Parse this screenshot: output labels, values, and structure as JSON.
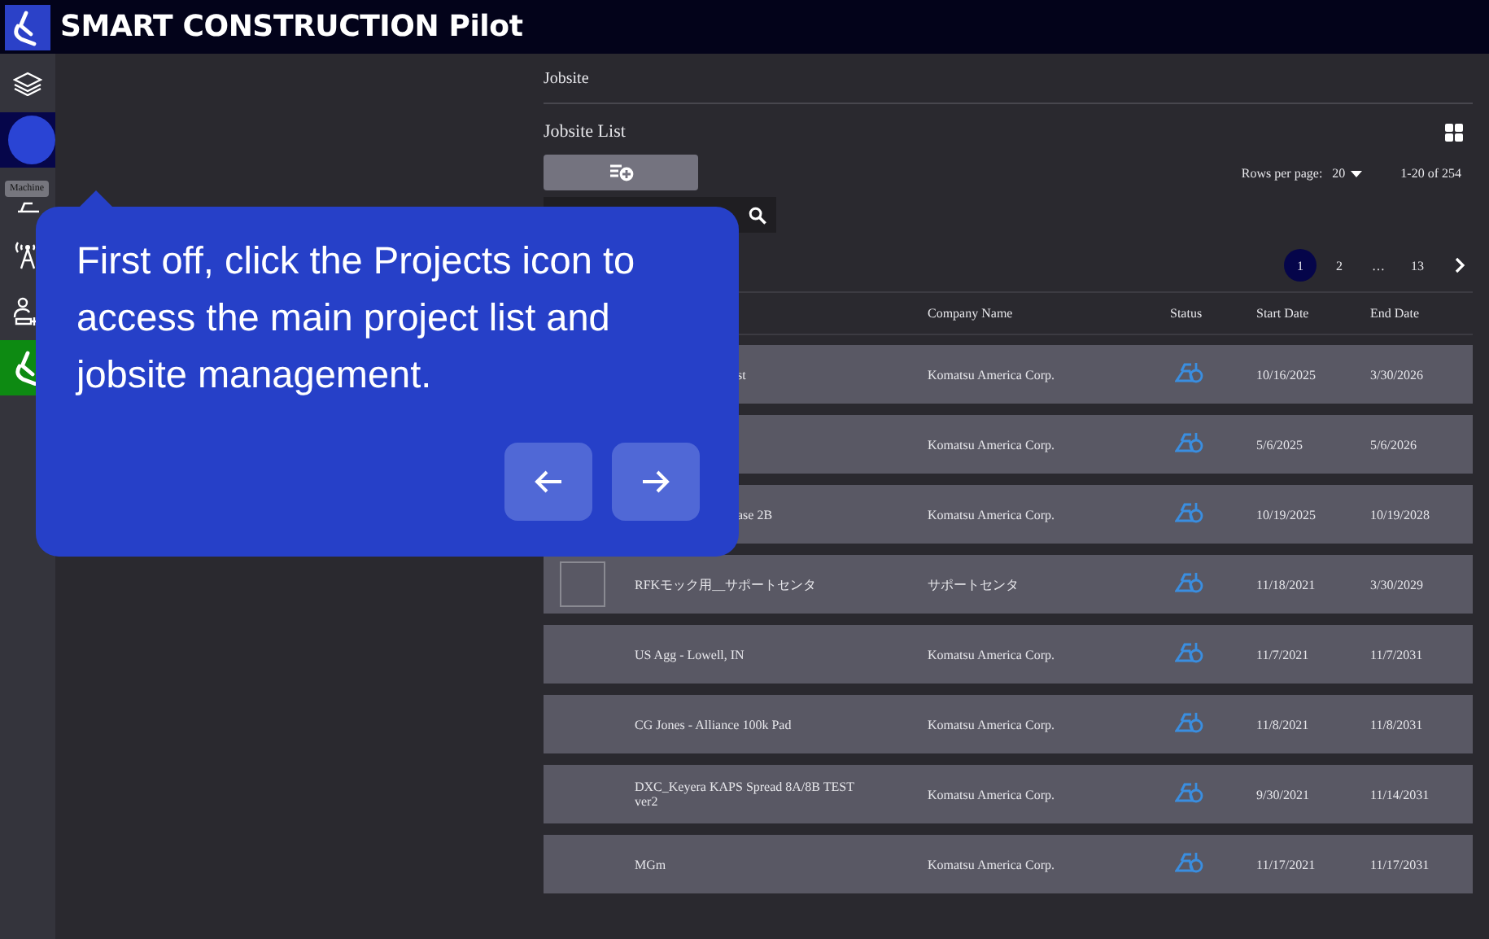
{
  "app": {
    "title": "SMART CONSTRUCTION Pilot"
  },
  "sidebar": {
    "items": [
      {
        "kind": "layers",
        "selected": false
      },
      {
        "kind": "spotlight",
        "selected": false
      },
      {
        "kind": "machine",
        "selected": false,
        "tooltip": "Machine"
      },
      {
        "kind": "antenna",
        "selected": false
      },
      {
        "kind": "useradd",
        "selected": false
      },
      {
        "kind": "logo",
        "selected": true
      }
    ]
  },
  "breadcrumb": "Jobsite",
  "list": {
    "title": "Jobsite List",
    "rows_per_page_label": "Rows per page:",
    "rows_per_page": "20",
    "range": "1-20 of 254",
    "pages": [
      {
        "label": "1",
        "selected": true
      },
      {
        "label": "2",
        "selected": false
      },
      {
        "label": "…",
        "selected": false
      },
      {
        "label": "13",
        "selected": false
      }
    ],
    "columns": [
      "Company Name",
      "Status",
      "Start Date",
      "End Date"
    ],
    "rows": [
      {
        "name": "st",
        "covered": true,
        "broken_image": false,
        "company": "Komatsu America Corp.",
        "start": "10/16/2025",
        "end": "3/30/2026"
      },
      {
        "broken_image": false,
        "company": "Komatsu America Corp.",
        "start": "5/6/2025",
        "end": "5/6/2026"
      },
      {
        "name": "ase 2B",
        "covered": true,
        "broken_image": false,
        "company": "Komatsu America Corp.",
        "start": "10/19/2025",
        "end": "10/19/2028"
      },
      {
        "name": "RFKモック用__サポートセンタ",
        "covered": false,
        "broken_image": true,
        "company": "サポートセンタ",
        "start": "11/18/2021",
        "end": "3/30/2029"
      },
      {
        "name": "US Agg - Lowell, IN",
        "covered": false,
        "broken_image": false,
        "company": "Komatsu America Corp.",
        "start": "11/7/2021",
        "end": "11/7/2031"
      },
      {
        "name": "CG Jones - Alliance 100k Pad",
        "covered": false,
        "broken_image": false,
        "company": "Komatsu America Corp.",
        "start": "11/8/2021",
        "end": "11/8/2031"
      },
      {
        "name": "DXC_Keyera KAPS Spread 8A/8B TEST ver2",
        "covered": false,
        "broken_image": false,
        "company": "Komatsu America Corp.",
        "start": "9/30/2021",
        "end": "11/14/2031"
      },
      {
        "name": "MGm",
        "covered": false,
        "broken_image": false,
        "company": "Komatsu America Corp.",
        "start": "11/17/2021",
        "end": "11/17/2031"
      }
    ]
  },
  "tour": {
    "text": "First off, click the Projects icon to access the main project list and jobsite management."
  }
}
